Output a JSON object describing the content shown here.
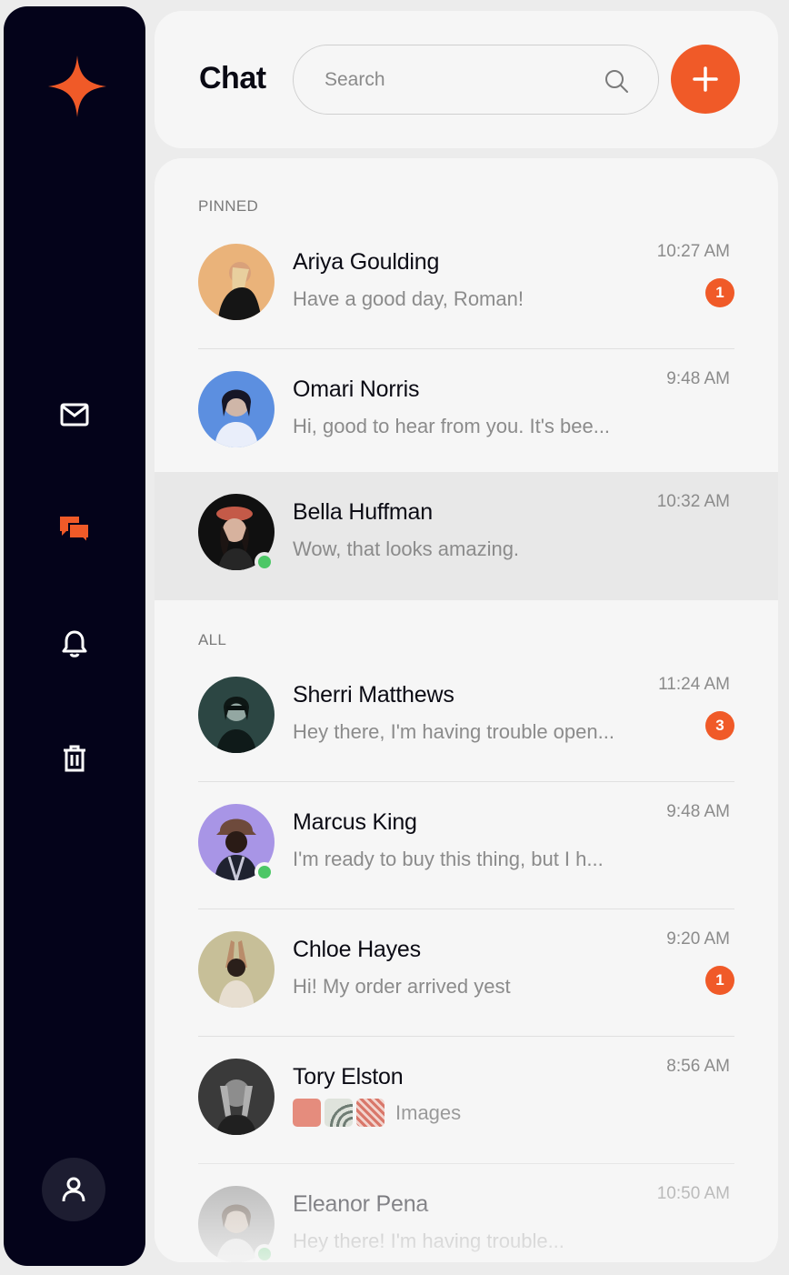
{
  "header": {
    "title": "Chat",
    "search_placeholder": "Search"
  },
  "sidebar": {
    "items": [
      {
        "name": "mail",
        "icon": "mail-icon",
        "active": false
      },
      {
        "name": "chat",
        "icon": "chat-bubbles-icon",
        "active": true
      },
      {
        "name": "notifications",
        "icon": "bell-icon",
        "active": false
      },
      {
        "name": "trash",
        "icon": "trash-icon",
        "active": false
      }
    ],
    "profile_icon": "user-icon"
  },
  "colors": {
    "accent": "#f05a28",
    "sidebar_bg": "#04031a",
    "online": "#4cc766"
  },
  "sections": {
    "pinned_label": "PINNED",
    "all_label": "ALL"
  },
  "pinned": [
    {
      "name": "Ariya Goulding",
      "preview": "Have a good day, Roman!",
      "time": "10:27 AM",
      "unread": "1",
      "online": false,
      "active": false
    },
    {
      "name": "Omari Norris",
      "preview": "Hi, good to hear from you. It's bee...",
      "time": "9:48 AM",
      "unread": null,
      "online": false,
      "active": false
    },
    {
      "name": "Bella Huffman",
      "preview": "Wow,  that looks amazing.",
      "time": "10:32 AM",
      "unread": null,
      "online": true,
      "active": true
    }
  ],
  "all": [
    {
      "name": "Sherri Matthews",
      "preview": "Hey there, I'm having trouble open...",
      "time": "11:24 AM",
      "unread": "3",
      "online": false
    },
    {
      "name": "Marcus King",
      "preview": "I'm ready to buy this thing, but I h...",
      "time": "9:48 AM",
      "unread": null,
      "online": true
    },
    {
      "name": "Chloe Hayes",
      "preview": "Hi! My order arrived yest",
      "time": "9:20 AM",
      "unread": "1",
      "online": false
    },
    {
      "name": "Tory Elston",
      "preview": "Images",
      "time": "8:56 AM",
      "unread": null,
      "online": false,
      "attachments": 3
    },
    {
      "name": "Eleanor Pena",
      "preview": "Hey there! I'm having trouble...",
      "time": "10:50 AM",
      "unread": null,
      "online": true
    }
  ]
}
